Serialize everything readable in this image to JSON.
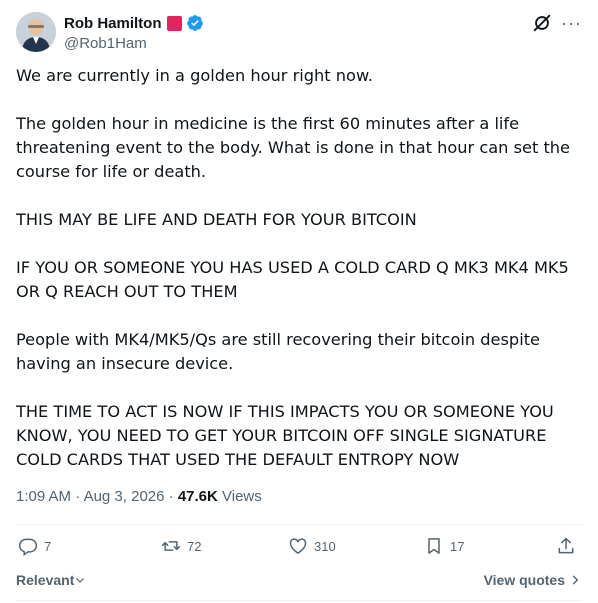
{
  "author": {
    "display_name": "Rob Hamilton",
    "handle": "@Rob1Ham",
    "verified_icon": "verified-badge-icon",
    "flag_icon": "red-square-flag"
  },
  "tweet": {
    "paragraphs": [
      "We are currently in a golden hour right now.",
      "The golden hour in medicine is the first 60 minutes after a life threatening event to the body. What is done in that hour can set the course for life or death.",
      "THIS MAY BE LIFE AND DEATH FOR YOUR BITCOIN",
      "IF YOU OR SOMEONE YOU HAS USED A COLD CARD Q MK3 MK4 MK5 OR Q REACH OUT TO THEM",
      "People with MK4/MK5/Qs are still recovering their bitcoin despite having an insecure device.",
      "THE TIME TO ACT IS NOW IF THIS IMPACTS YOU OR SOMEONE YOU KNOW, YOU NEED TO GET YOUR BITCOIN OFF SINGLE SIGNATURE COLD CARDS THAT USED THE DEFAULT ENTROPY NOW"
    ]
  },
  "meta": {
    "time": "1:09 AM",
    "separator": " · ",
    "date": "Aug 3, 2026",
    "views_count": "47.6K",
    "views_label": " Views"
  },
  "actions": {
    "replies": "7",
    "reposts": "72",
    "likes": "310",
    "bookmarks": "17"
  },
  "footer": {
    "sort_label": "Relevant",
    "view_quotes_label": "View quotes"
  },
  "colors": {
    "text": "#0f1419",
    "muted": "#536471",
    "verified": "#1d9bf0",
    "flag": "#e0245e"
  }
}
